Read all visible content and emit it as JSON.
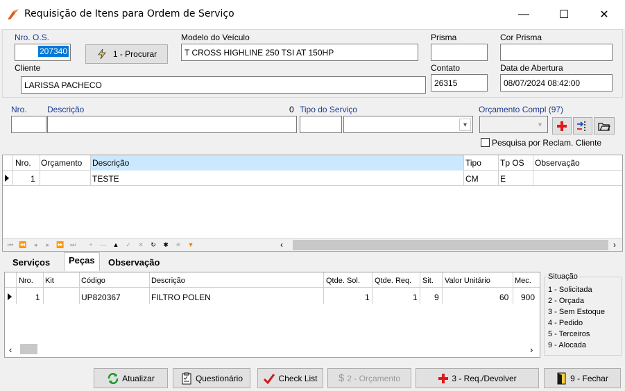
{
  "window": {
    "title": "Requisição de Itens para Ordem de Serviço",
    "minimize": "—",
    "maximize": "☐",
    "close": "✕"
  },
  "header": {
    "os_label": "Nro. O.S.",
    "os_value": "207340",
    "procurar_label": "1 - Procurar",
    "modelo_label": "Modelo do Veículo",
    "modelo_value": "T CROSS HIGHLINE 250 TSI AT 150HP",
    "prisma_label": "Prisma",
    "prisma_value": "",
    "cor_prisma_label": "Cor Prisma",
    "cor_prisma_value": "",
    "cliente_label": "Cliente",
    "cliente_value": "LARISSA PACHECO",
    "contato_label": "Contato",
    "contato_value": "26315",
    "data_label": "Data de Abertura",
    "data_value": "08/07/2024 08:42:00"
  },
  "filter": {
    "nro_label": "Nro.",
    "descricao_label": "Descrição",
    "count": "0",
    "tipo_servico_label": "Tipo do Serviço",
    "orcamento_label": "Orçamento Compl (97)",
    "reclam_label": "Pesquisa por Reclam. Cliente"
  },
  "services_grid": {
    "columns": [
      "Nro.",
      "Orçamento",
      "Descrição",
      "Tipo",
      "Tp OS",
      "Observação"
    ],
    "rows": [
      {
        "nro": "1",
        "orcamento": "",
        "descricao": "TESTE",
        "tipo": "CM",
        "tp_os": "E",
        "observacao": ""
      }
    ]
  },
  "tabs": [
    "Serviços",
    "Peças",
    "Observação"
  ],
  "parts_grid": {
    "columns": [
      "Nro.",
      "Kit",
      "Código",
      "Descrição",
      "Qtde. Sol.",
      "Qtde. Req.",
      "Sit.",
      "Valor Unitário",
      "Mec."
    ],
    "rows": [
      {
        "nro": "1",
        "kit": "",
        "codigo": "UP820367",
        "descricao": "FILTRO POLEN",
        "qtde_sol": "1",
        "qtde_req": "1",
        "sit": "9",
        "valor": "60",
        "mec": "900"
      }
    ]
  },
  "situacao": {
    "title": "Situação",
    "items": [
      "1 - Solicitada",
      "2 - Orçada",
      "3 - Sem Estoque",
      "4 - Pedido",
      "5 - Terceiros",
      "9 - Alocada"
    ]
  },
  "footer": {
    "atualizar": "Atualizar",
    "questionario": "Questionário",
    "checklist": "Check List",
    "orcamento": "2 - Orçamento",
    "req_devolver": "3 - Req./Devolver",
    "fechar": "9 - Fechar"
  }
}
